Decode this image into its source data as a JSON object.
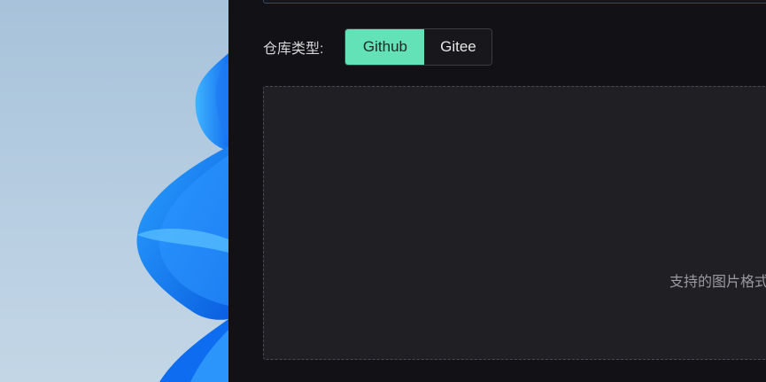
{
  "repo": {
    "label": "仓库类型:",
    "options": [
      "Github",
      "Gitee"
    ],
    "selected": "Github"
  },
  "upload": {
    "hint": "支持的图片格式"
  },
  "colors": {
    "accent": "#63e2b7",
    "panel_bg": "#111116",
    "upload_bg": "#1f1f24"
  }
}
